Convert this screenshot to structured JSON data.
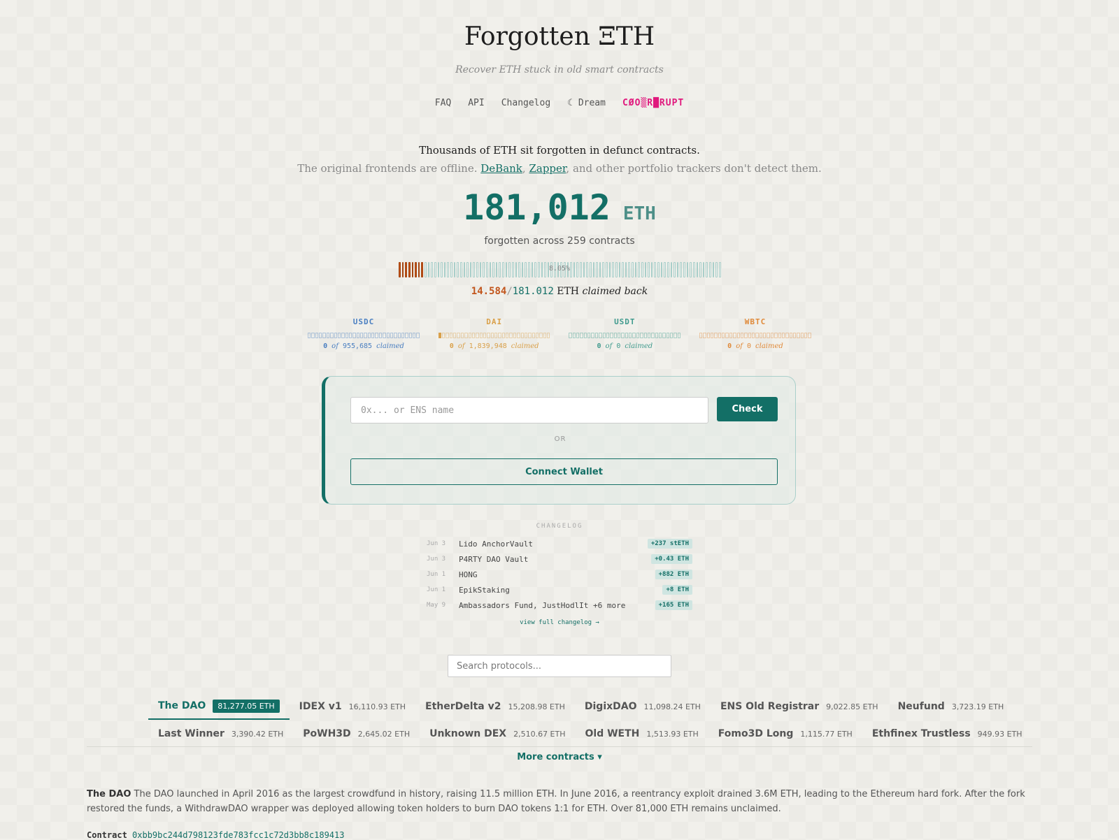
{
  "header": {
    "title": "Forgotten ΞTH",
    "tagline": "Recover ETH stuck in old smart contracts"
  },
  "nav": {
    "faq": "FAQ",
    "api": "API",
    "changelog": "Changelog",
    "dream": "☾ Dream",
    "corrupt": "CØO▒R█RUPT"
  },
  "intro": {
    "line1": "Thousands of ETH sit forgotten in defunct contracts.",
    "line2_prefix": "The original frontends are offline.",
    "link_debank": "DeBank",
    "sep": ",",
    "link_zapper": "Zapper",
    "line2_suffix": ", and other portfolio trackers don't detect them."
  },
  "stats": {
    "total": "181,012",
    "unit": "ETH",
    "subtitle": "forgotten across 259 contracts",
    "progress_fraction": 0.0805,
    "progress_label": "8.05%",
    "claimed": "14.584",
    "slash": "/",
    "total_short": "181.012",
    "claimed_unit": "ETH",
    "claimed_suffix": "claimed back"
  },
  "tokens": [
    {
      "symbol": "USDC",
      "claimed": "0",
      "of_text": "of",
      "total": "955,685",
      "suffix": "claimed",
      "fraction": 0,
      "color": "#4a7fc1"
    },
    {
      "symbol": "DAI",
      "claimed": "0",
      "of_text": "of",
      "total": "1,839,948",
      "suffix": "claimed",
      "fraction": 0.01,
      "color": "#d9a04a"
    },
    {
      "symbol": "USDT",
      "claimed": "0",
      "of_text": "of",
      "total": "0",
      "suffix": "claimed",
      "fraction": 0,
      "color": "#3f9a8d"
    },
    {
      "symbol": "WBTC",
      "claimed": "0",
      "of_text": "of",
      "total": "0",
      "suffix": "claimed",
      "fraction": 0,
      "color": "#e08a3a"
    }
  ],
  "check": {
    "placeholder": "0x... or ENS name",
    "check_label": "Check",
    "or_label": "OR",
    "connect_label": "Connect Wallet"
  },
  "changelog": {
    "title": "CHANGELOG",
    "entries": [
      {
        "date": "Jun 3",
        "name": "Lido AnchorVault",
        "badge": "+237 stETH"
      },
      {
        "date": "Jun 3",
        "name": "P4RTY DAO Vault",
        "badge": "+0.43 ETH"
      },
      {
        "date": "Jun 1",
        "name": "HONG",
        "badge": "+882 ETH"
      },
      {
        "date": "Jun 1",
        "name": "EpikStaking",
        "badge": "+8 ETH"
      },
      {
        "date": "May 9",
        "name": "Ambassadors Fund, JustHodlIt +6 more",
        "badge": "+165 ETH"
      }
    ],
    "more": "view full changelog →"
  },
  "search": {
    "placeholder": "Search protocols..."
  },
  "protocols": {
    "row1": [
      {
        "name": "The DAO",
        "value": "81,277.05 ETH",
        "active": true
      },
      {
        "name": "IDEX v1",
        "value": "16,110.93 ETH"
      },
      {
        "name": "EtherDelta v2",
        "value": "15,208.98 ETH"
      },
      {
        "name": "DigixDAO",
        "value": "11,098.24 ETH"
      },
      {
        "name": "ENS Old Registrar",
        "value": "9,022.85 ETH"
      },
      {
        "name": "Neufund",
        "value": "3,723.19 ETH"
      }
    ],
    "row2": [
      {
        "name": "Last Winner",
        "value": "3,390.42 ETH"
      },
      {
        "name": "PoWH3D",
        "value": "2,645.02 ETH"
      },
      {
        "name": "Unknown DEX",
        "value": "2,510.67 ETH"
      },
      {
        "name": "Old WETH",
        "value": "1,513.93 ETH"
      },
      {
        "name": "Fomo3D Long",
        "value": "1,115.77 ETH"
      },
      {
        "name": "Ethfinex Trustless",
        "value": "949.93 ETH"
      }
    ],
    "more_label": "More contracts ▾"
  },
  "detail": {
    "name": "The DAO",
    "text": "The DAO launched in April 2016 as the largest crowdfund in history, raising 11.5 million ETH. In June 2016, a reentrancy exploit drained 3.6M ETH, leading to the Ethereum hard fork. After the fork restored the funds, a WithdrawDAO wrapper was deployed allowing token holders to burn DAO tokens 1:1 for ETH. Over 81,000 ETH remains unclaimed.",
    "contract_label": "Contract",
    "contract_address": "0xbb9bc244d798123fde783fcc1c72d3bb8c189413"
  }
}
